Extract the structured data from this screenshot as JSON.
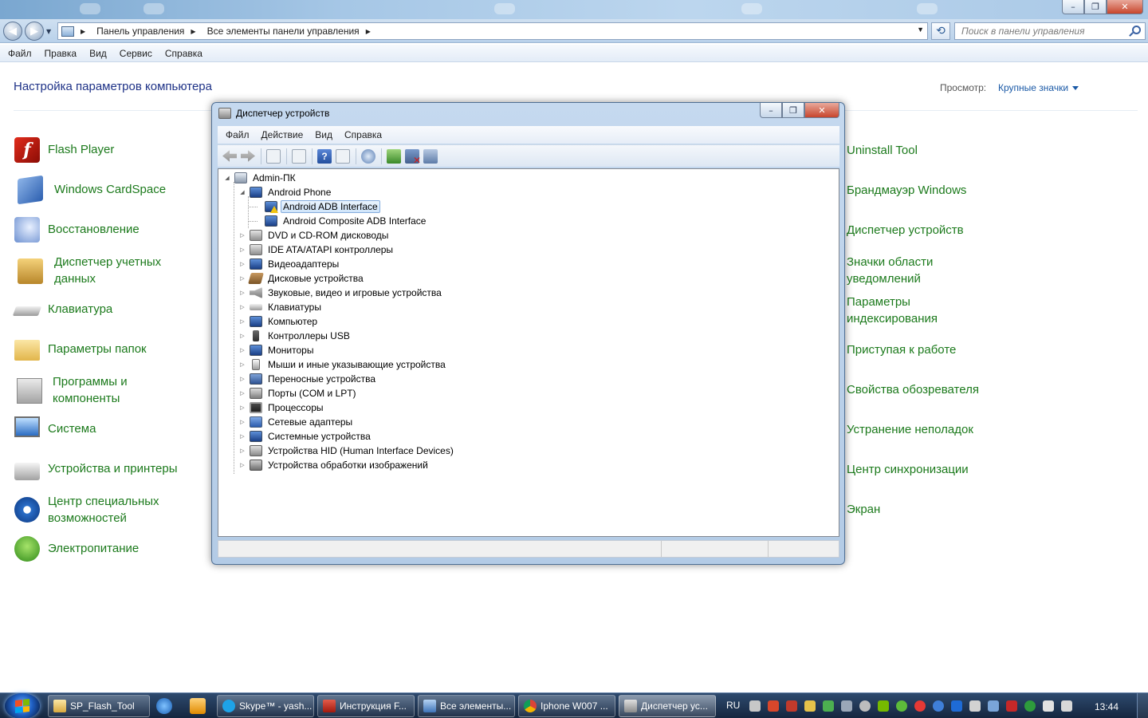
{
  "explorer": {
    "breadcrumbs": [
      "Панель управления",
      "Все элементы панели управления"
    ],
    "search_placeholder": "Поиск в панели управления",
    "menu": [
      "Файл",
      "Правка",
      "Вид",
      "Сервис",
      "Справка"
    ]
  },
  "control_panel": {
    "header": "Настройка параметров компьютера",
    "view_label": "Просмотр:",
    "view_value": "Крупные значки",
    "left_items": [
      {
        "label": "Flash Player",
        "icon": "flash-icon"
      },
      {
        "label": "Windows CardSpace",
        "icon": "cardspace-icon"
      },
      {
        "label": "Восстановление",
        "icon": "restore-icon"
      },
      {
        "label": "Диспетчер учетных данных",
        "icon": "credential-icon"
      },
      {
        "label": "Клавиатура",
        "icon": "keyboard-icon"
      },
      {
        "label": "Параметры папок",
        "icon": "folder-icon"
      },
      {
        "label": "Программы и компоненты",
        "icon": "programs-icon"
      },
      {
        "label": "Система",
        "icon": "system-icon"
      },
      {
        "label": "Устройства и принтеры",
        "icon": "printer-icon"
      },
      {
        "label": "Центр специальных возможностей",
        "icon": "accessibility-icon"
      },
      {
        "label": "Электропитание",
        "icon": "power-icon"
      }
    ],
    "right_items": [
      {
        "label": "Uninstall Tool"
      },
      {
        "label": "Брандмауэр Windows"
      },
      {
        "label": "Диспетчер устройств"
      },
      {
        "label": "Значки области уведомлений"
      },
      {
        "label": "Параметры индексирования"
      },
      {
        "label": "Приступая к работе"
      },
      {
        "label": "Свойства обозревателя"
      },
      {
        "label": "Устранение неполадок"
      },
      {
        "label": "Центр синхронизации"
      },
      {
        "label": "Экран"
      }
    ]
  },
  "device_manager": {
    "title": "Диспетчер устройств",
    "menu": [
      "Файл",
      "Действие",
      "Вид",
      "Справка"
    ],
    "root": "Admin-ПК",
    "android_group": "Android Phone",
    "android_children": [
      "Android ADB Interface",
      "Android Composite ADB Interface"
    ],
    "categories": [
      "DVD и CD-ROM дисководы",
      "IDE ATA/ATAPI контроллеры",
      "Видеоадаптеры",
      "Дисковые устройства",
      "Звуковые, видео и игровые устройства",
      "Клавиатуры",
      "Компьютер",
      "Контроллеры USB",
      "Мониторы",
      "Мыши и иные указывающие устройства",
      "Переносные устройства",
      "Порты (COM и LPT)",
      "Процессоры",
      "Сетевые адаптеры",
      "Системные устройства",
      "Устройства HID (Human Interface Devices)",
      "Устройства обработки изображений"
    ]
  },
  "taskbar": {
    "buttons": [
      {
        "label": "SP_Flash_Tool",
        "icon": "folder-icon"
      },
      {
        "label": "Skype™ - yash...",
        "icon": "skype-icon"
      },
      {
        "label": "Инструкция F...",
        "icon": "pdf-icon"
      },
      {
        "label": "Все элементы...",
        "icon": "control-panel-icon"
      },
      {
        "label": "Iphone W007 ...",
        "icon": "chrome-icon"
      },
      {
        "label": "Диспетчер ус...",
        "icon": "device-manager-icon"
      }
    ],
    "language": "RU",
    "clock": "13:44"
  }
}
